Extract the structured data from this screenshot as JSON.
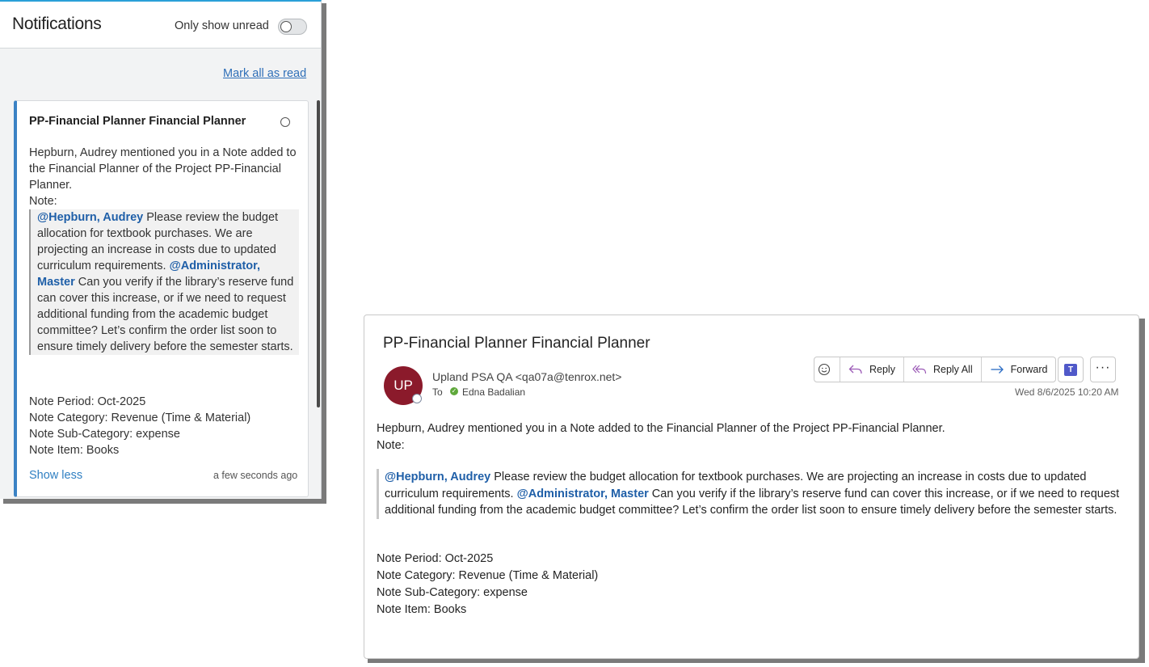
{
  "notifications": {
    "title": "Notifications",
    "only_unread_label": "Only show unread",
    "mark_all_label": "Mark all as read",
    "card": {
      "title": "PP-Financial Planner Financial Planner",
      "intro": "Hepburn, Audrey mentioned you in a Note added to the Financial Planner of the Project PP-Financial Planner.",
      "note_label": "Note:",
      "mention1": "@Hepburn, Audrey",
      "text1": " Please review the budget allocation for textbook purchases. We are projecting an increase in costs due to updated curriculum requirements. ",
      "mention2": "@Administrator, Master",
      "text2": " Can you verify if the library’s reserve fund can cover this increase, or if we need to request additional funding from the academic budget committee? Let’s confirm the order list soon to ensure timely delivery before the semester starts.",
      "period": "Note Period: Oct-2025",
      "category": "Note Category: Revenue (Time & Material)",
      "subcategory": "Note Sub-Category: expense",
      "item": "Note Item: Books",
      "show_less": "Show less",
      "time": "a few seconds ago"
    }
  },
  "email": {
    "subject": "PP-Financial Planner Financial Planner",
    "avatar_initials": "UP",
    "avatar_color": "#8b1a2b",
    "sender": "Upland PSA QA <qa07a@tenrox.net>",
    "to_label": "To",
    "recipient": "Edna Badalian",
    "actions": {
      "reply": "Reply",
      "reply_all": "Reply All",
      "forward": "Forward"
    },
    "date": "Wed 8/6/2025 10:20 AM",
    "intro": "Hepburn, Audrey mentioned you in a Note added to the Financial Planner of the Project PP-Financial Planner.",
    "note_label": "Note:",
    "mention1": "@Hepburn, Audrey",
    "text1": " Please review the budget allocation for textbook purchases. We are projecting an increase in costs due to updated curriculum requirements. ",
    "mention2": "@Administrator, Master",
    "text2": " Can you verify if the library’s reserve fund can cover this increase, or if we need to request additional funding from the academic budget committee? Let’s confirm the order list soon to ensure timely delivery before the semester starts.",
    "period": "Note Period: Oct-2025",
    "category": "Note Category: Revenue (Time & Material)",
    "subcategory": "Note Sub-Category: expense",
    "item": "Note Item: Books"
  },
  "icons": [
    "emoji-icon",
    "reply-icon",
    "reply-all-icon",
    "forward-icon",
    "teams-icon",
    "more-icon"
  ]
}
